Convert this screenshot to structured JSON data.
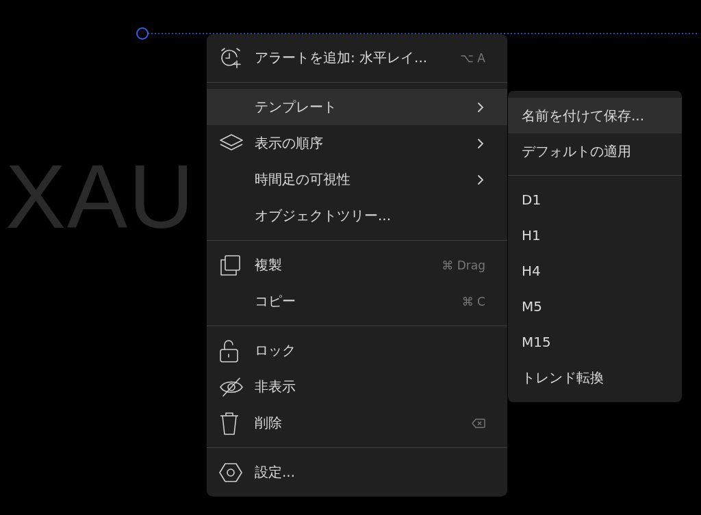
{
  "chart": {
    "watermark": "XAU"
  },
  "context_menu": {
    "sections": [
      [
        {
          "kind": "alert",
          "label": "アラートを追加: 水平レイ...",
          "shortcut": "⌥ A",
          "submenu": false,
          "selected": false
        }
      ],
      [
        {
          "kind": "plain",
          "label": "テンプレート",
          "submenu": true,
          "selected": true
        },
        {
          "kind": "order",
          "label": "表示の順序",
          "submenu": true,
          "selected": false
        },
        {
          "kind": "plain",
          "label": "時間足の可視性",
          "submenu": true,
          "selected": false
        },
        {
          "kind": "plain",
          "label": "オブジェクトツリー...",
          "submenu": false,
          "selected": false
        }
      ],
      [
        {
          "kind": "clone",
          "label": "複製",
          "shortcut": "⌘ Drag",
          "submenu": false,
          "selected": false
        },
        {
          "kind": "plain",
          "label": "コピー",
          "shortcut": "⌘ C",
          "submenu": false,
          "selected": false
        }
      ],
      [
        {
          "kind": "lock",
          "label": "ロック",
          "submenu": false,
          "selected": false
        },
        {
          "kind": "hide",
          "label": "非表示",
          "submenu": false,
          "selected": false
        },
        {
          "kind": "delete",
          "label": "削除",
          "delete_key_hint": true,
          "submenu": false,
          "selected": false
        }
      ],
      [
        {
          "kind": "settings",
          "label": "設定...",
          "submenu": false,
          "selected": false
        }
      ]
    ]
  },
  "template_submenu": {
    "sections": [
      [
        {
          "label": "名前を付けて保存...",
          "selected": true
        },
        {
          "label": "デフォルトの適用",
          "selected": false
        }
      ],
      [
        {
          "label": "D1",
          "selected": false
        },
        {
          "label": "H1",
          "selected": false
        },
        {
          "label": "H4",
          "selected": false
        },
        {
          "label": "M5",
          "selected": false
        },
        {
          "label": "M15",
          "selected": false
        },
        {
          "label": "トレンド転換",
          "selected": false
        }
      ]
    ]
  }
}
